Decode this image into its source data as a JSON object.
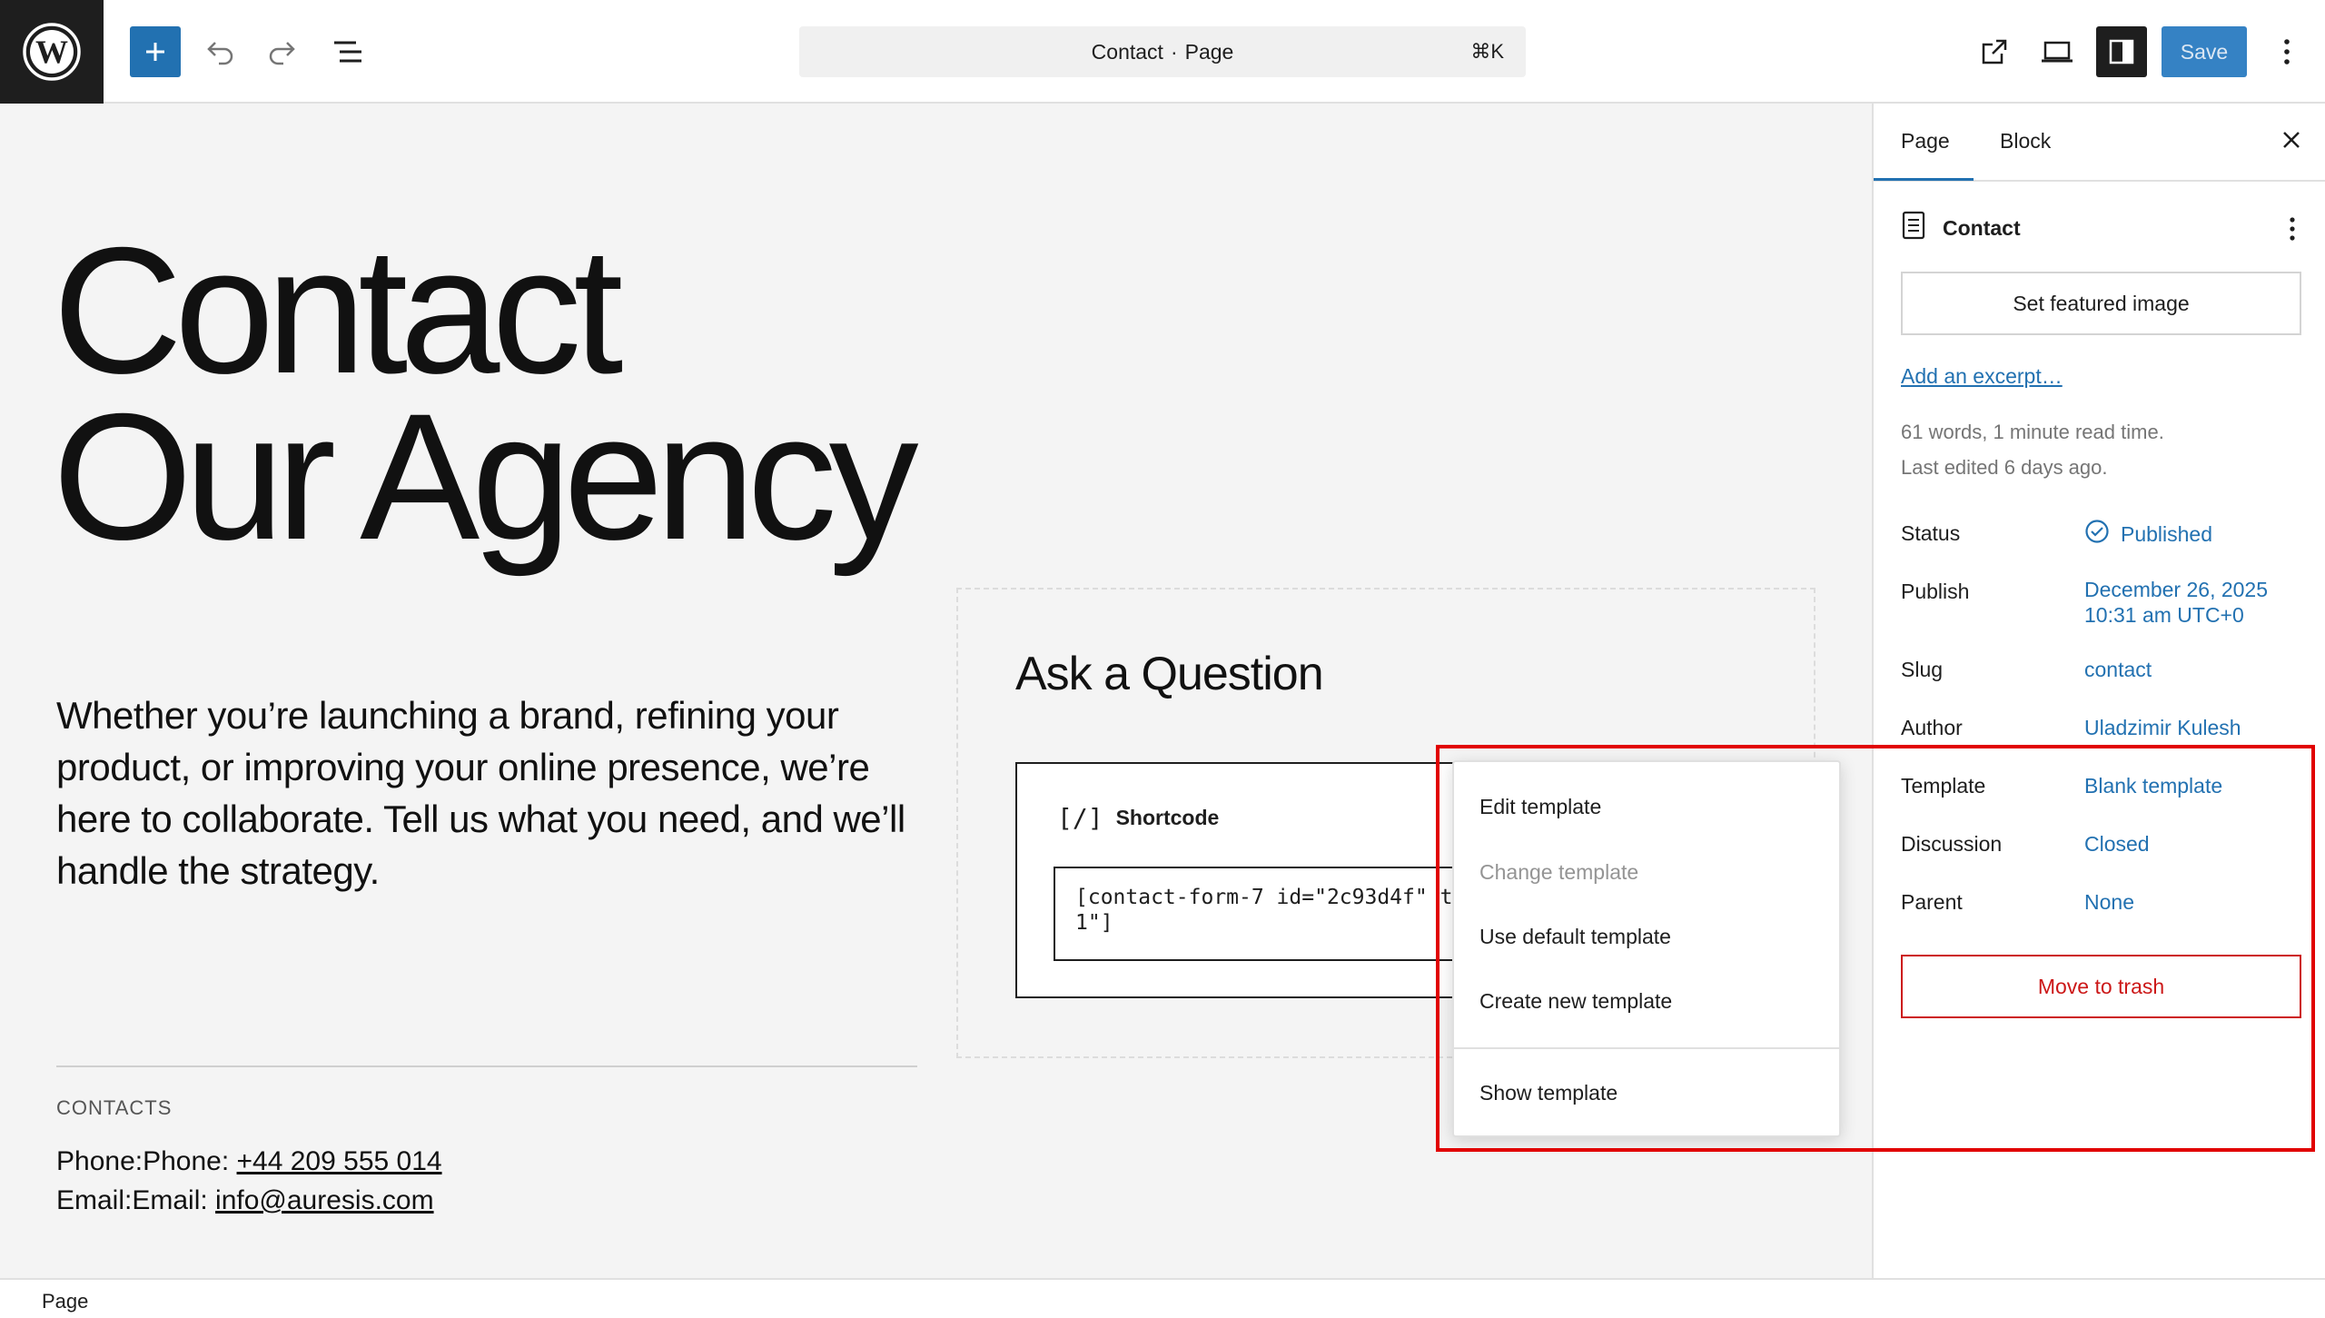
{
  "toolbar": {
    "title": "Contact",
    "separator": "·",
    "type": "Page",
    "shortcut": "⌘K",
    "save_label": "Save"
  },
  "content": {
    "heading_line1": "Contact",
    "heading_line2": "Our Agency",
    "intro": "Whether you’re launching a brand, refining your product, or improving your online presence, we’re here to collaborate. Tell us what you need, and we’ll handle the strategy.",
    "contacts_label": "CONTACTS",
    "phone_prefix": "Phone:Phone: ",
    "phone": "+44 209 555 014",
    "email_prefix": "Email:Email: ",
    "email": "info@auresis.com",
    "form_title": "Ask a Question",
    "shortcode_label": "Shortcode",
    "shortcode_icon": "[/]",
    "shortcode_value": "[contact-form-7 id=\"2c93d4f\" t\n1\"]"
  },
  "sidebar": {
    "tabs": [
      "Page",
      "Block"
    ],
    "doc_title": "Contact",
    "featured_image_label": "Set featured image",
    "excerpt_link": "Add an excerpt…",
    "word_count": "61 words, 1 minute read time.",
    "last_edited": "Last edited 6 days ago.",
    "props": {
      "status_label": "Status",
      "status_value": "Published",
      "publish_label": "Publish",
      "publish_value_line1": "December 26, 2025",
      "publish_value_line2": "10:31 am UTC+0",
      "slug_label": "Slug",
      "slug_value": "contact",
      "author_label": "Author",
      "author_value": "Uladzimir Kulesh",
      "template_label": "Template",
      "template_value": "Blank template",
      "discussion_label": "Discussion",
      "discussion_value": "Closed",
      "parent_label": "Parent",
      "parent_value": "None"
    },
    "trash_label": "Move to trash"
  },
  "template_menu": {
    "items": [
      "Edit template",
      "Change template",
      "Use default template",
      "Create new template",
      "Show template"
    ]
  },
  "statusbar": {
    "label": "Page"
  },
  "colors": {
    "accent": "#2271b1",
    "danger": "#cc1818",
    "highlight": "#e10000"
  }
}
